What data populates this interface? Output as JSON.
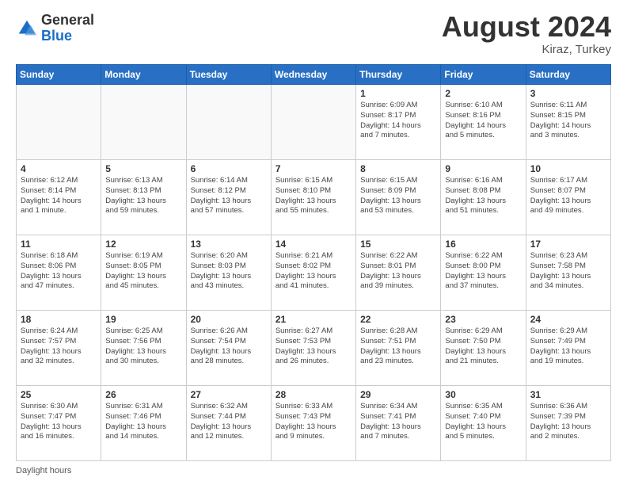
{
  "header": {
    "logo_general": "General",
    "logo_blue": "Blue",
    "month_year": "August 2024",
    "location": "Kiraz, Turkey"
  },
  "footer": {
    "daylight_label": "Daylight hours"
  },
  "days_of_week": [
    "Sunday",
    "Monday",
    "Tuesday",
    "Wednesday",
    "Thursday",
    "Friday",
    "Saturday"
  ],
  "weeks": [
    [
      {
        "day": "",
        "info": ""
      },
      {
        "day": "",
        "info": ""
      },
      {
        "day": "",
        "info": ""
      },
      {
        "day": "",
        "info": ""
      },
      {
        "day": "1",
        "info": "Sunrise: 6:09 AM\nSunset: 8:17 PM\nDaylight: 14 hours\nand 7 minutes."
      },
      {
        "day": "2",
        "info": "Sunrise: 6:10 AM\nSunset: 8:16 PM\nDaylight: 14 hours\nand 5 minutes."
      },
      {
        "day": "3",
        "info": "Sunrise: 6:11 AM\nSunset: 8:15 PM\nDaylight: 14 hours\nand 3 minutes."
      }
    ],
    [
      {
        "day": "4",
        "info": "Sunrise: 6:12 AM\nSunset: 8:14 PM\nDaylight: 14 hours\nand 1 minute."
      },
      {
        "day": "5",
        "info": "Sunrise: 6:13 AM\nSunset: 8:13 PM\nDaylight: 13 hours\nand 59 minutes."
      },
      {
        "day": "6",
        "info": "Sunrise: 6:14 AM\nSunset: 8:12 PM\nDaylight: 13 hours\nand 57 minutes."
      },
      {
        "day": "7",
        "info": "Sunrise: 6:15 AM\nSunset: 8:10 PM\nDaylight: 13 hours\nand 55 minutes."
      },
      {
        "day": "8",
        "info": "Sunrise: 6:15 AM\nSunset: 8:09 PM\nDaylight: 13 hours\nand 53 minutes."
      },
      {
        "day": "9",
        "info": "Sunrise: 6:16 AM\nSunset: 8:08 PM\nDaylight: 13 hours\nand 51 minutes."
      },
      {
        "day": "10",
        "info": "Sunrise: 6:17 AM\nSunset: 8:07 PM\nDaylight: 13 hours\nand 49 minutes."
      }
    ],
    [
      {
        "day": "11",
        "info": "Sunrise: 6:18 AM\nSunset: 8:06 PM\nDaylight: 13 hours\nand 47 minutes."
      },
      {
        "day": "12",
        "info": "Sunrise: 6:19 AM\nSunset: 8:05 PM\nDaylight: 13 hours\nand 45 minutes."
      },
      {
        "day": "13",
        "info": "Sunrise: 6:20 AM\nSunset: 8:03 PM\nDaylight: 13 hours\nand 43 minutes."
      },
      {
        "day": "14",
        "info": "Sunrise: 6:21 AM\nSunset: 8:02 PM\nDaylight: 13 hours\nand 41 minutes."
      },
      {
        "day": "15",
        "info": "Sunrise: 6:22 AM\nSunset: 8:01 PM\nDaylight: 13 hours\nand 39 minutes."
      },
      {
        "day": "16",
        "info": "Sunrise: 6:22 AM\nSunset: 8:00 PM\nDaylight: 13 hours\nand 37 minutes."
      },
      {
        "day": "17",
        "info": "Sunrise: 6:23 AM\nSunset: 7:58 PM\nDaylight: 13 hours\nand 34 minutes."
      }
    ],
    [
      {
        "day": "18",
        "info": "Sunrise: 6:24 AM\nSunset: 7:57 PM\nDaylight: 13 hours\nand 32 minutes."
      },
      {
        "day": "19",
        "info": "Sunrise: 6:25 AM\nSunset: 7:56 PM\nDaylight: 13 hours\nand 30 minutes."
      },
      {
        "day": "20",
        "info": "Sunrise: 6:26 AM\nSunset: 7:54 PM\nDaylight: 13 hours\nand 28 minutes."
      },
      {
        "day": "21",
        "info": "Sunrise: 6:27 AM\nSunset: 7:53 PM\nDaylight: 13 hours\nand 26 minutes."
      },
      {
        "day": "22",
        "info": "Sunrise: 6:28 AM\nSunset: 7:51 PM\nDaylight: 13 hours\nand 23 minutes."
      },
      {
        "day": "23",
        "info": "Sunrise: 6:29 AM\nSunset: 7:50 PM\nDaylight: 13 hours\nand 21 minutes."
      },
      {
        "day": "24",
        "info": "Sunrise: 6:29 AM\nSunset: 7:49 PM\nDaylight: 13 hours\nand 19 minutes."
      }
    ],
    [
      {
        "day": "25",
        "info": "Sunrise: 6:30 AM\nSunset: 7:47 PM\nDaylight: 13 hours\nand 16 minutes."
      },
      {
        "day": "26",
        "info": "Sunrise: 6:31 AM\nSunset: 7:46 PM\nDaylight: 13 hours\nand 14 minutes."
      },
      {
        "day": "27",
        "info": "Sunrise: 6:32 AM\nSunset: 7:44 PM\nDaylight: 13 hours\nand 12 minutes."
      },
      {
        "day": "28",
        "info": "Sunrise: 6:33 AM\nSunset: 7:43 PM\nDaylight: 13 hours\nand 9 minutes."
      },
      {
        "day": "29",
        "info": "Sunrise: 6:34 AM\nSunset: 7:41 PM\nDaylight: 13 hours\nand 7 minutes."
      },
      {
        "day": "30",
        "info": "Sunrise: 6:35 AM\nSunset: 7:40 PM\nDaylight: 13 hours\nand 5 minutes."
      },
      {
        "day": "31",
        "info": "Sunrise: 6:36 AM\nSunset: 7:39 PM\nDaylight: 13 hours\nand 2 minutes."
      }
    ]
  ]
}
